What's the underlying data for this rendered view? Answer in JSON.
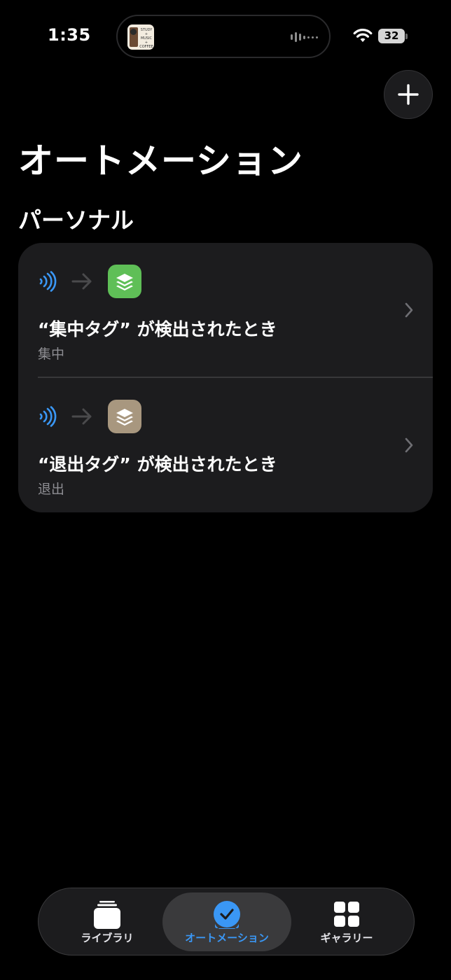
{
  "status_bar": {
    "time": "1:35",
    "battery": "32",
    "now_playing_art": "STUDY\n+\nMUSIC\n+\nCOFFEE"
  },
  "header": {
    "title": "オートメーション",
    "add_icon": "plus-icon"
  },
  "section": {
    "title": "パーソナル"
  },
  "automations": [
    {
      "title": "“集中タグ” が検出されたとき",
      "subtitle": "集中",
      "trigger_icon": "nfc-icon",
      "app_icon": "focus-stack-icon",
      "app_color": "#5fbf57"
    },
    {
      "title": "“退出タグ” が検出されたとき",
      "subtitle": "退出",
      "trigger_icon": "nfc-icon",
      "app_icon": "focus-stack-icon",
      "app_color": "#a8977f"
    }
  ],
  "tab_bar": {
    "tabs": [
      {
        "label": "ライブラリ",
        "icon": "library-stack-icon"
      },
      {
        "label": "オートメーション",
        "icon": "automation-clock-icon",
        "selected": true
      },
      {
        "label": "ギャラリー",
        "icon": "gallery-grid-icon"
      }
    ]
  },
  "colors": {
    "accent": "#3a97f5",
    "background": "#000000",
    "card": "#1c1c1e"
  }
}
